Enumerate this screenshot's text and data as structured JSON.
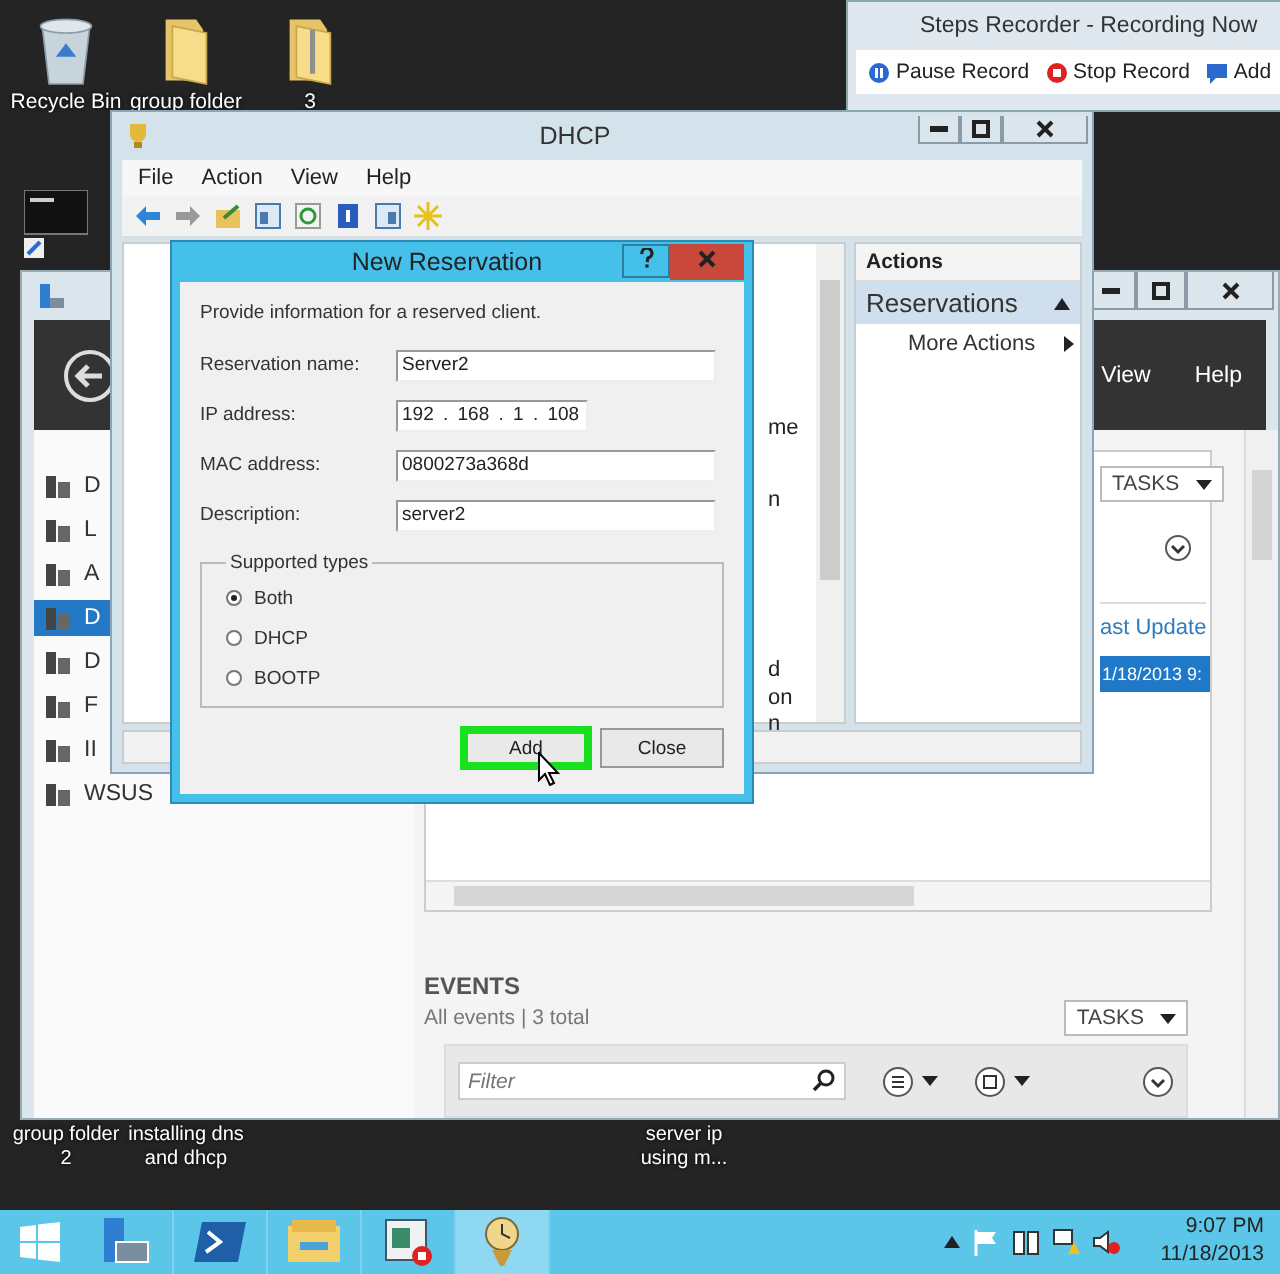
{
  "desktop_icons": [
    {
      "label": "Recycle Bin",
      "kind": "recycle-bin"
    },
    {
      "label": "group folder",
      "kind": "folder"
    },
    {
      "label": "3",
      "kind": "zip-folder"
    }
  ],
  "desktop_labels": [
    {
      "lines": [
        "group folder",
        "2"
      ]
    },
    {
      "lines": [
        "installing dns",
        "and dhcp"
      ]
    },
    {
      "lines": [
        "server ip",
        "using m..."
      ]
    }
  ],
  "steps_recorder": {
    "title": "Steps Recorder - Recording Now",
    "buttons": [
      {
        "label": "Pause Record",
        "kind": "pause"
      },
      {
        "label": "Stop Record",
        "kind": "stop"
      },
      {
        "label": "Add",
        "kind": "add"
      }
    ]
  },
  "server_manager": {
    "menu": [
      "View",
      "Help"
    ],
    "nav": [
      {
        "label": "D",
        "selected": false
      },
      {
        "label": "L",
        "selected": false
      },
      {
        "label": "A",
        "selected": false
      },
      {
        "label": "D",
        "selected": true
      },
      {
        "label": "D",
        "selected": false
      },
      {
        "label": "F",
        "selected": false
      },
      {
        "label": "II",
        "selected": false
      },
      {
        "label": "WSUS",
        "selected": false
      }
    ],
    "panel": {
      "tasks": "TASKS",
      "column": "ast Update",
      "row": "1/18/2013 9:"
    },
    "events": {
      "title": "EVENTS",
      "subtitle": "All events | 3 total",
      "tasks": "TASKS",
      "filter": {
        "placeholder": "Filter"
      }
    }
  },
  "dhcp": {
    "title": "DHCP",
    "menu": [
      "File",
      "Action",
      "View",
      "Help"
    ],
    "center_fragments": [
      "me",
      "n",
      "d",
      "on",
      "n"
    ],
    "actions": {
      "title": "Actions",
      "section": "Reservations",
      "items": [
        "More Actions"
      ]
    }
  },
  "new_reservation": {
    "title": "New Reservation",
    "intro": "Provide information for a reserved client.",
    "fields": [
      {
        "label": "Reservation name:",
        "value": "Server2"
      },
      {
        "label": "IP address:",
        "value": "192 . 168 . 1 . 108"
      },
      {
        "label": "MAC address:",
        "value": "0800273a368d"
      },
      {
        "label": "Description:",
        "value": "server2"
      }
    ],
    "group": "Supported types",
    "options": [
      {
        "label": "Both",
        "selected": true
      },
      {
        "label": "DHCP",
        "selected": false
      },
      {
        "label": "BOOTP",
        "selected": false
      }
    ],
    "buttons": [
      {
        "label": "Add",
        "highlighted": true
      },
      {
        "label": "Close",
        "highlighted": false
      }
    ]
  },
  "taskbar": {
    "apps": [
      {
        "kind": "server-manager",
        "active": false
      },
      {
        "kind": "powershell",
        "active": false
      },
      {
        "kind": "explorer",
        "active": false
      },
      {
        "kind": "recorder",
        "active": false
      },
      {
        "kind": "clock-app",
        "active": true
      }
    ],
    "time": "9:07 PM",
    "date": "11/18/2013"
  }
}
